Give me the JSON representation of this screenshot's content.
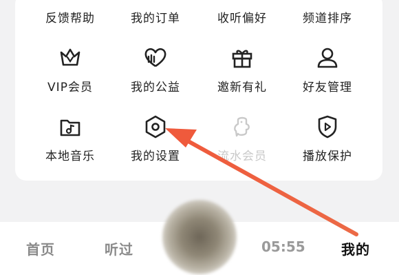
{
  "menu_top_row": [
    "反馈帮助",
    "我的订单",
    "收听偏好",
    "频道排序"
  ],
  "menu_grid": [
    {
      "label": "VIP会员",
      "icon": "crown-icon"
    },
    {
      "label": "我的公益",
      "icon": "heart-icon"
    },
    {
      "label": "邀新有礼",
      "icon": "gift-icon"
    },
    {
      "label": "好友管理",
      "icon": "user-icon"
    },
    {
      "label": "本地音乐",
      "icon": "music-folder-icon"
    },
    {
      "label": "我的设置",
      "icon": "settings-hexagon-icon"
    },
    {
      "label": "流水会员",
      "icon": "mascot-icon"
    },
    {
      "label": "播放保护",
      "icon": "shield-play-icon"
    }
  ],
  "tabs": {
    "home": "首页",
    "listened": "听过",
    "time": "05:55",
    "mine": "我的"
  },
  "colors": {
    "arrow": "#ef5a3c",
    "background": "#f2f2f3",
    "card": "#ffffff"
  }
}
